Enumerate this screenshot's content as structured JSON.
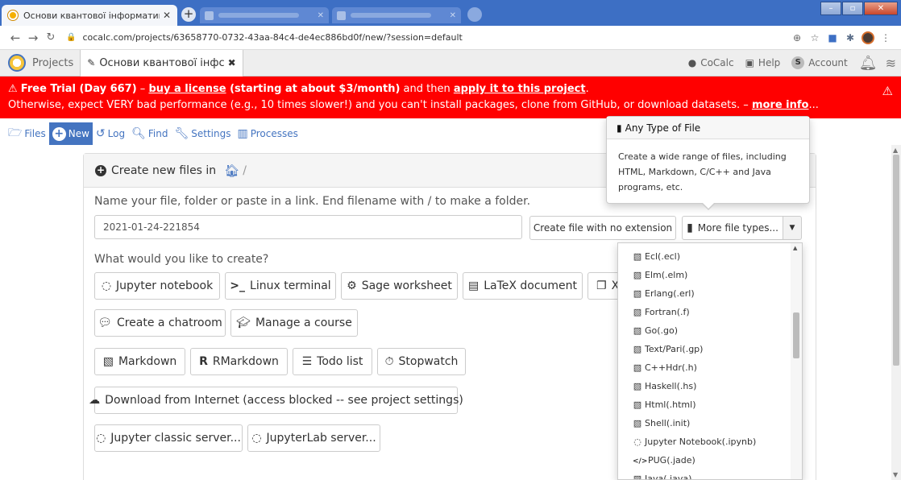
{
  "browser": {
    "active_tab_title": "Основи квантової інформатики",
    "url": "cocalc.com/projects/63658770-0732-43aa-84c4-de4ec886bd0f/new/?session=default"
  },
  "cocalc_nav": {
    "projects_label": "Projects",
    "project_tab_label": "Основи квантової інфс",
    "cocalc_label": "CoCalc",
    "help_label": "Help",
    "account_badge": "S",
    "account_label": "Account"
  },
  "banner": {
    "trial_label": "Free Trial (Day 667)",
    "dash1": " – ",
    "buy_link": "buy a license",
    "pricing": " (starting at about $3/month)",
    "and_then": " and then ",
    "apply_link": "apply it to this project",
    "period": ".",
    "line2": "Otherwise, expect VERY bad performance (e.g., 10 times slower!) and you can't install packages, clone from GitHub, or download datasets. – ",
    "more_info": "more info",
    "ellipsis": "..."
  },
  "subnav": {
    "files": "Files",
    "new": "New",
    "log": "Log",
    "find": "Find",
    "settings": "Settings",
    "processes": "Processes"
  },
  "panel": {
    "header": "Create new files in",
    "path_sep": "/",
    "prompt": "Name your file, folder or paste in a link. End filename with / to make a folder.",
    "filename_value": "2021-01-24-221854",
    "create_no_ext": "Create file with no extension",
    "more_types": "More file types...",
    "question": "What would you like to create?"
  },
  "create_buttons": {
    "jupyter": "Jupyter notebook",
    "terminal": "Linux terminal",
    "sage": "Sage worksheet",
    "latex": "LaTeX document",
    "x11_partial": "X",
    "chatroom": "Create a chatroom",
    "course": "Manage a course",
    "markdown": "Markdown",
    "rmarkdown": "RMarkdown",
    "todo": "Todo list",
    "stopwatch": "Stopwatch",
    "download": "Download from Internet (access blocked -- see project settings)",
    "jupyter_classic": "Jupyter classic server...",
    "jupyterlab": "JupyterLab server..."
  },
  "tooltip": {
    "title": "Any Type of File",
    "body": "Create a wide range of files, including HTML, Markdown, C/C++ and Java programs, etc."
  },
  "file_types": [
    {
      "label": "Ecl(.ecl)",
      "icon": "file-code-icon"
    },
    {
      "label": "Elm(.elm)",
      "icon": "file-code-icon"
    },
    {
      "label": "Erlang(.erl)",
      "icon": "file-code-icon"
    },
    {
      "label": "Fortran(.f)",
      "icon": "file-code-icon"
    },
    {
      "label": "Go(.go)",
      "icon": "file-code-icon"
    },
    {
      "label": "Text/Pari(.gp)",
      "icon": "file-code-icon"
    },
    {
      "label": "C++Hdr(.h)",
      "icon": "file-code-icon"
    },
    {
      "label": "Haskell(.hs)",
      "icon": "file-code-icon"
    },
    {
      "label": "Html(.html)",
      "icon": "file-code-icon"
    },
    {
      "label": "Shell(.init)",
      "icon": "file-code-icon"
    },
    {
      "label": "Jupyter Notebook(.ipynb)",
      "icon": "jupyter-icon"
    },
    {
      "label": "PUG(.jade)",
      "icon": "code-icon"
    },
    {
      "label": "Java(.java)",
      "icon": "file-code-icon"
    }
  ],
  "colors": {
    "banner_bg": "#ff0000",
    "accent": "#4474c0",
    "chrome_tabstrip": "#3d6fc4"
  }
}
